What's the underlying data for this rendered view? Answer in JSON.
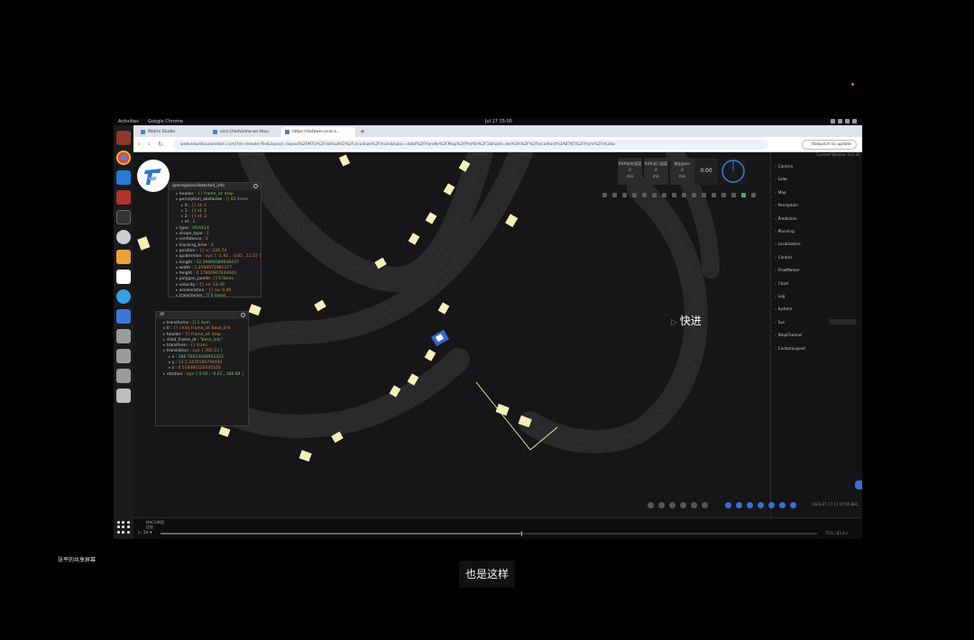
{
  "topbar": {
    "activities": "Activities",
    "app_name": "Google Chrome",
    "clock": "Jul 17 15:05"
  },
  "browser": {
    "tabs": [
      {
        "label": "Matrix Studio"
      },
      {
        "label": "arcs://redvisme-ws.thou"
      },
      {
        "label": "https://datawin-scie.a..."
      }
    ],
    "url": "webview.thousandsim.com/?ds-remote-file&layout=layout%2FMTU%2FdefaultV2%2Fvisualize%2Fmain&topic=data%2FHandle%2FMap%2FProfile%2F1&hash=ws%3A%2F%2Flocalhost%3A8765%2Ffrom%2Fstudio",
    "relaunch_label": "Relaunch to update",
    "nav_glyphs": "‹ › ↻"
  },
  "panels": {
    "perception": {
      "title": "/perception/detected_info",
      "rows": [
        {
          "k": "header",
          "v": "{} frame_id: map"
        },
        {
          "k": "perception_obstacles",
          "v": "[] 82 items"
        },
        {
          "k": "0",
          "v": "{} id: 1"
        },
        {
          "k": "1",
          "v": "{} id: 2"
        },
        {
          "k": "2",
          "v": "{} id: 3"
        },
        {
          "k": "id",
          "v": "3"
        },
        {
          "k": "type",
          "v": "VEHICLE"
        },
        {
          "k": "shape_type",
          "v": "1"
        },
        {
          "k": "confidence",
          "v": "0"
        },
        {
          "k": "tracking_time",
          "v": "0"
        },
        {
          "k": "position",
          "v": "{} x: -334.74"
        },
        {
          "k": "quaternion",
          "v": "xyz: [ -1.92 , -3.85 , 12.57 ]"
        },
        {
          "k": "length",
          "v": "12.39999389648437"
        },
        {
          "k": "width",
          "v": "1.2596671981377"
        },
        {
          "k": "height",
          "v": "0.17800907634440"
        },
        {
          "k": "polygon_points",
          "v": "[] 4 items"
        },
        {
          "k": "velocity",
          "v": "{} vx: 14.49"
        },
        {
          "k": "acceleration",
          "v": "{} ax: 0.00"
        },
        {
          "k": "trajectories",
          "v": "[] 0 items"
        },
        {
          "k": "detection_sources",
          "v": "\"...\""
        }
      ]
    },
    "tf": {
      "title": "/tf",
      "rows": [
        {
          "k": "transforms",
          "v": "[] 1 item"
        },
        {
          "k": "0",
          "v": "{} child_frame_id: base_link"
        },
        {
          "k": "header",
          "v": "{} frame_id: map"
        },
        {
          "k": "child_frame_id",
          "v": "\"base_link\""
        },
        {
          "k": "transform",
          "v": "{} trans"
        },
        {
          "k": "translation",
          "v": "xyz: [ 392.23 ]"
        },
        {
          "k": "x",
          "v": "386.76654448952422"
        },
        {
          "k": "y",
          "v": "13.1.2435589794493"
        },
        {
          "k": "z",
          "v": "0.514481520545520"
        },
        {
          "k": "rotation",
          "v": "xyz: [ 0.02 , -0.01 , 180.84 ]"
        }
      ]
    }
  },
  "status_boxes": [
    {
      "l1": "RSN前进速度",
      "l2": "0",
      "l3": "m/s"
    },
    {
      "l1": "RSN油门速度",
      "l2": "0",
      "l3": "m/s"
    },
    {
      "l1": "输出gear",
      "l2": "0",
      "l3": "m/s"
    },
    {
      "l1": "输出gear",
      "l2": "0",
      "l3": "m/s"
    }
  ],
  "speed_value": "0.00",
  "right_panel": {
    "header": "Current Version: 0.0.32",
    "items": [
      "Camera",
      "Lidar",
      "Map",
      "Perception",
      "Prediction",
      "Planning",
      "Localization",
      "Control",
      "FlowMarker",
      "Chart",
      "Log",
      "System",
      "Sys",
      "StepChannel",
      "CustomLayout"
    ]
  },
  "playback": {
    "timestamp": "2023-07-17 17:07:05.891",
    "speed": "1x",
    "progress": 0.55,
    "time_readout": "75.6 / 83.4 s",
    "bag_label": "MACSIM面\n回放"
  },
  "overlay": {
    "fast_forward": "快进",
    "subtitle": "也是这样",
    "sharer": "张平的共享屏幕"
  },
  "colors": {
    "accent_blue": "#3a6fd8",
    "vehicle_yellow": "#f5f1b0",
    "ego_blue": "#3a66c9",
    "record_dot": "#e07a1a"
  }
}
